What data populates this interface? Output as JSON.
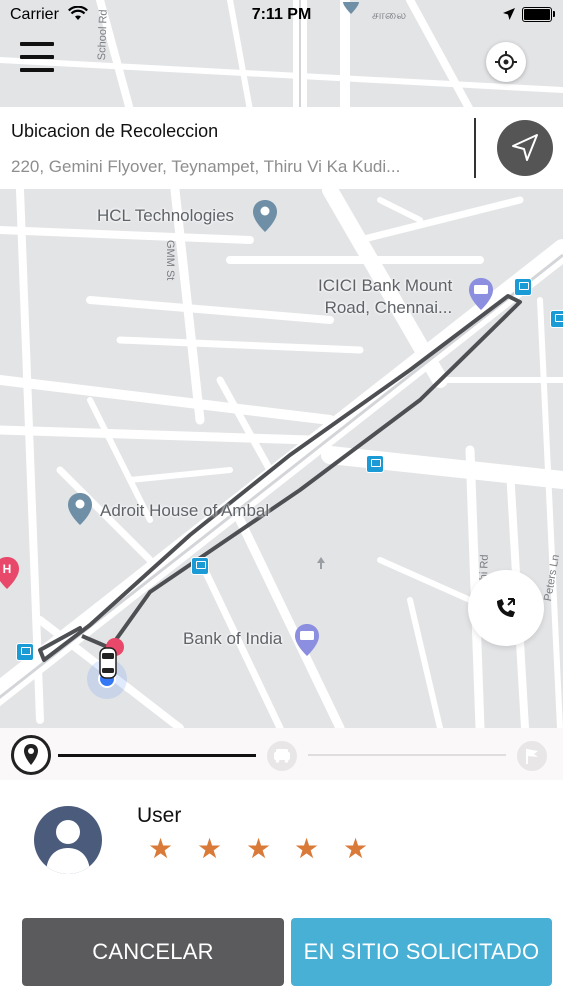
{
  "status_bar": {
    "carrier": "Carrier",
    "time": "7:11 PM",
    "icons": [
      "wifi-icon",
      "location-arrow-icon",
      "battery-icon"
    ]
  },
  "map": {
    "street_labels": [
      "School Rd",
      "GMM St",
      "Peters Ln",
      "hi Rd"
    ],
    "top_partial_label": "சாலை",
    "pois": [
      {
        "name": "HCL Technologies",
        "icon": "place-pin-icon"
      },
      {
        "name": "ICICI Bank Mount Road, Chennai...",
        "icon": "bank-pin-icon"
      },
      {
        "name": "Adroit House of Ambal",
        "icon": "place-pin-icon"
      },
      {
        "name": "Bank of India",
        "icon": "bank-pin-icon"
      }
    ],
    "colors": {
      "background": "#e3e4e6",
      "road": "#ffffff",
      "route": "#4d4f53",
      "user_dot": "#3478f6",
      "hospital_pin": "#e8486a",
      "transit": "#1a9bd6"
    }
  },
  "pickup": {
    "title": "Ubicacion de Recoleccion",
    "address": "220, Gemini Flyover, Teynampet, Thiru Vi Ka Kudi...",
    "nav_icon": "navigation-arrow-icon"
  },
  "controls": {
    "menu_icon": "hamburger-menu-icon",
    "locate_icon": "crosshair-icon",
    "call_icon": "phone-call-icon"
  },
  "tracker": {
    "steps": [
      "location-pin-icon",
      "car-icon",
      "finish-flag-icon"
    ],
    "progress": 0.5
  },
  "user": {
    "name": "User",
    "rating": 5,
    "max_rating": 5,
    "star_color": "#d97a38"
  },
  "actions": {
    "cancel_label": "CANCELAR",
    "arrived_label": "EN SITIO SOLICITADO",
    "cancel_color": "#5b5a5c",
    "arrived_color": "#48b0d4"
  }
}
